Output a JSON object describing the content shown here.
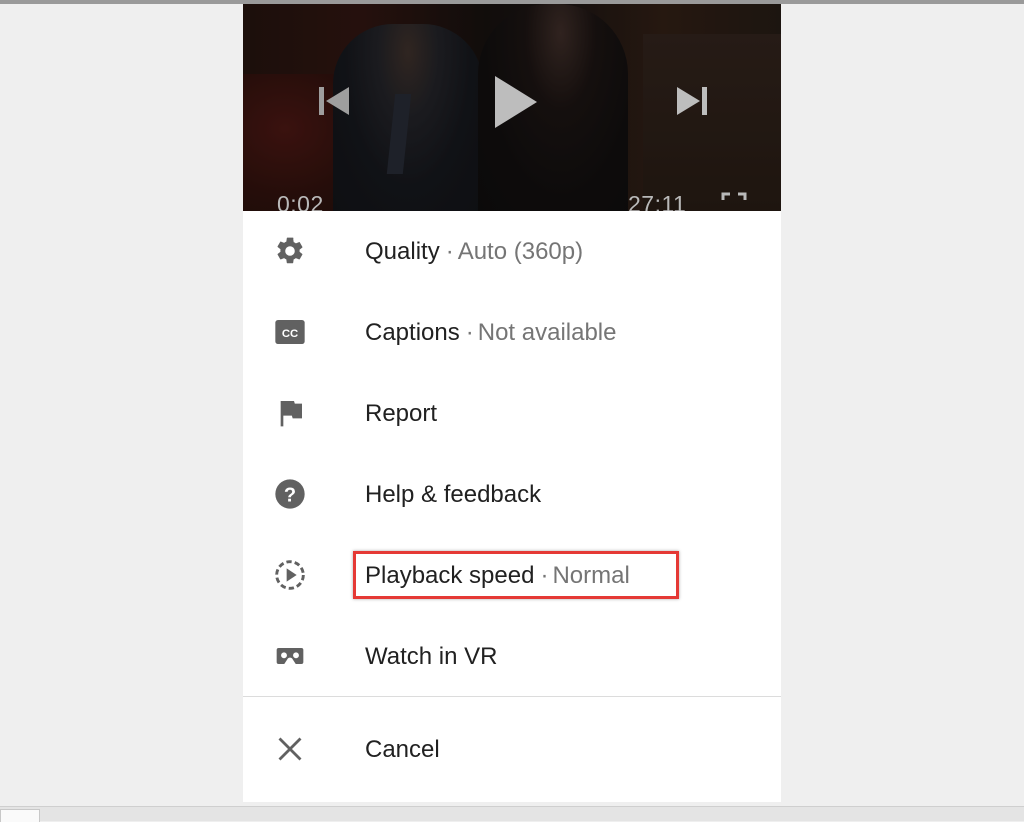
{
  "video": {
    "current_time": "0:02",
    "total_time": "27:11"
  },
  "menu": {
    "separator": "·",
    "items": [
      {
        "label": "Quality",
        "value": "Auto (360p)",
        "icon": "gear-icon"
      },
      {
        "label": "Captions",
        "value": "Not available",
        "icon": "closed-captions-icon"
      },
      {
        "label": "Report",
        "icon": "flag-icon"
      },
      {
        "label": "Help & feedback",
        "icon": "help-icon"
      },
      {
        "label": "Playback speed",
        "value": "Normal",
        "icon": "playback-speed-icon"
      },
      {
        "label": "Watch in VR",
        "icon": "vr-headset-icon"
      }
    ],
    "cancel_label": "Cancel"
  },
  "colors": {
    "highlight": "#e53935",
    "icon": "#616161",
    "text_primary": "#212121",
    "text_secondary": "#757575"
  }
}
